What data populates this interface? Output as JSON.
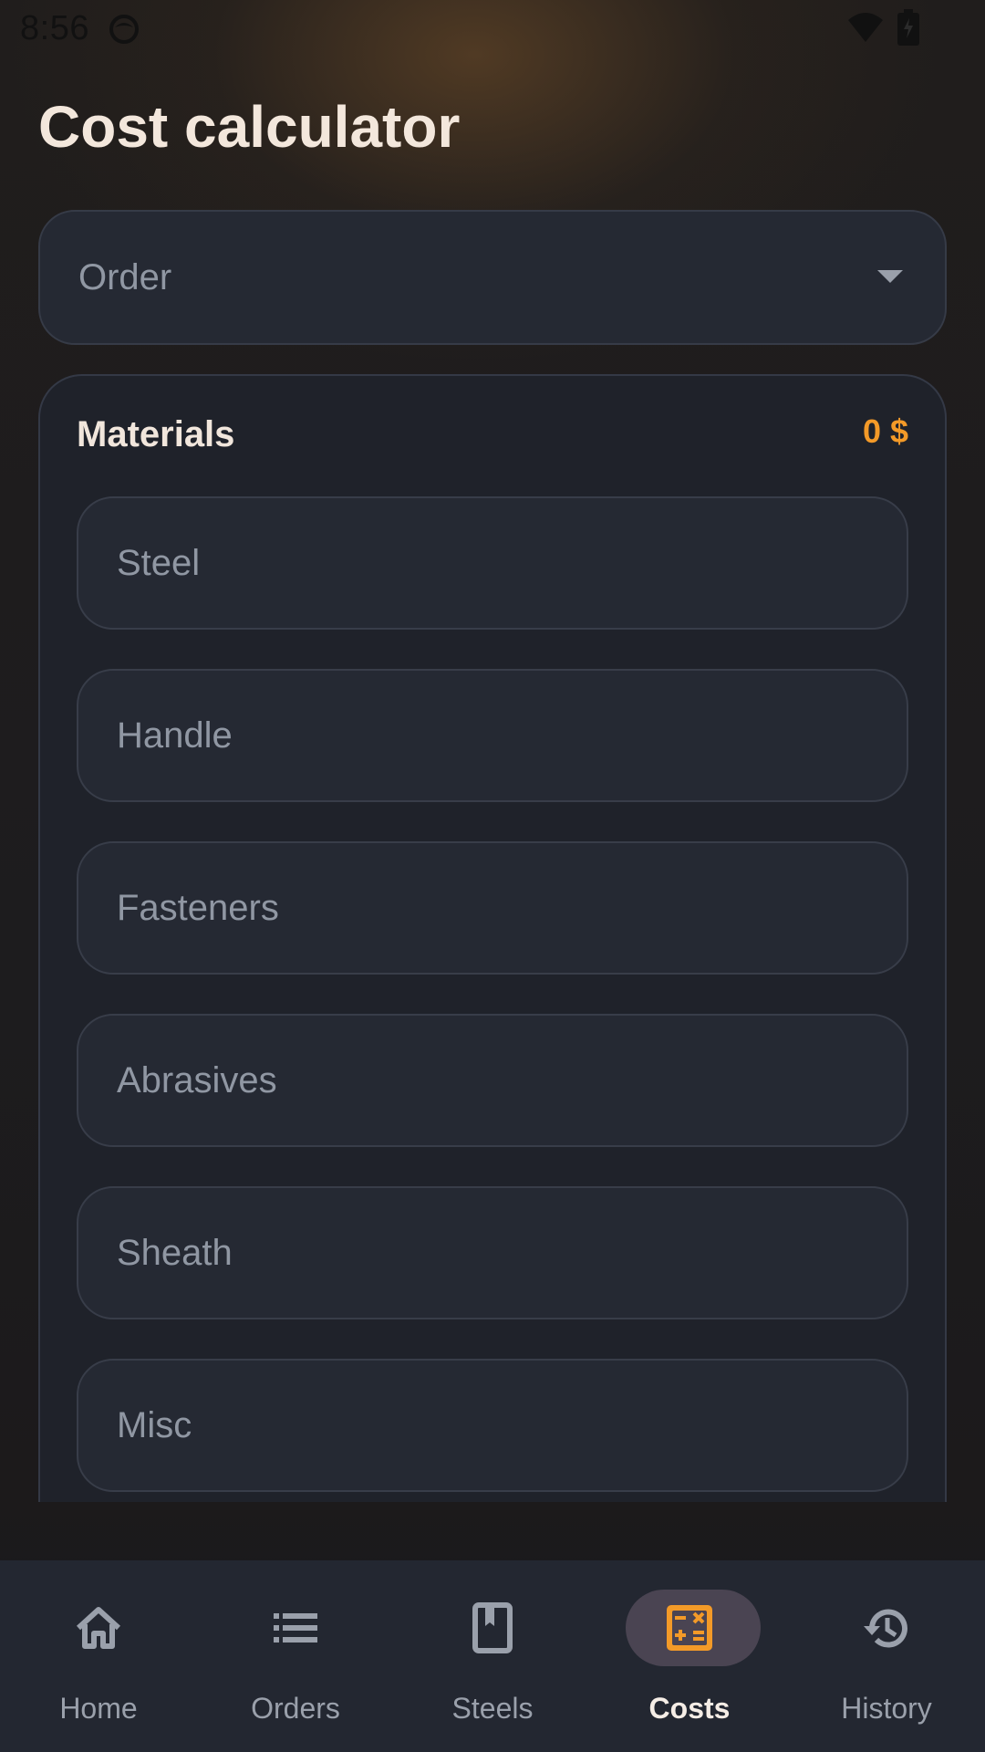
{
  "status_bar": {
    "time": "8:56"
  },
  "page": {
    "title": "Cost calculator"
  },
  "order_select": {
    "placeholder": "Order"
  },
  "materials": {
    "title": "Materials",
    "total": "0 $",
    "fields": [
      "Steel",
      "Handle",
      "Fasteners",
      "Abrasives",
      "Sheath",
      "Misc"
    ]
  },
  "nav": {
    "items": [
      {
        "label": "Home",
        "icon": "home-icon"
      },
      {
        "label": "Orders",
        "icon": "list-icon"
      },
      {
        "label": "Steels",
        "icon": "book-icon"
      },
      {
        "label": "Costs",
        "icon": "calculator-icon",
        "active": true
      },
      {
        "label": "History",
        "icon": "history-icon"
      }
    ]
  },
  "colors": {
    "accent": "#f39a28",
    "active_pill": "#4a4452",
    "nav_bg": "#232731",
    "field_bg": "#252933"
  }
}
